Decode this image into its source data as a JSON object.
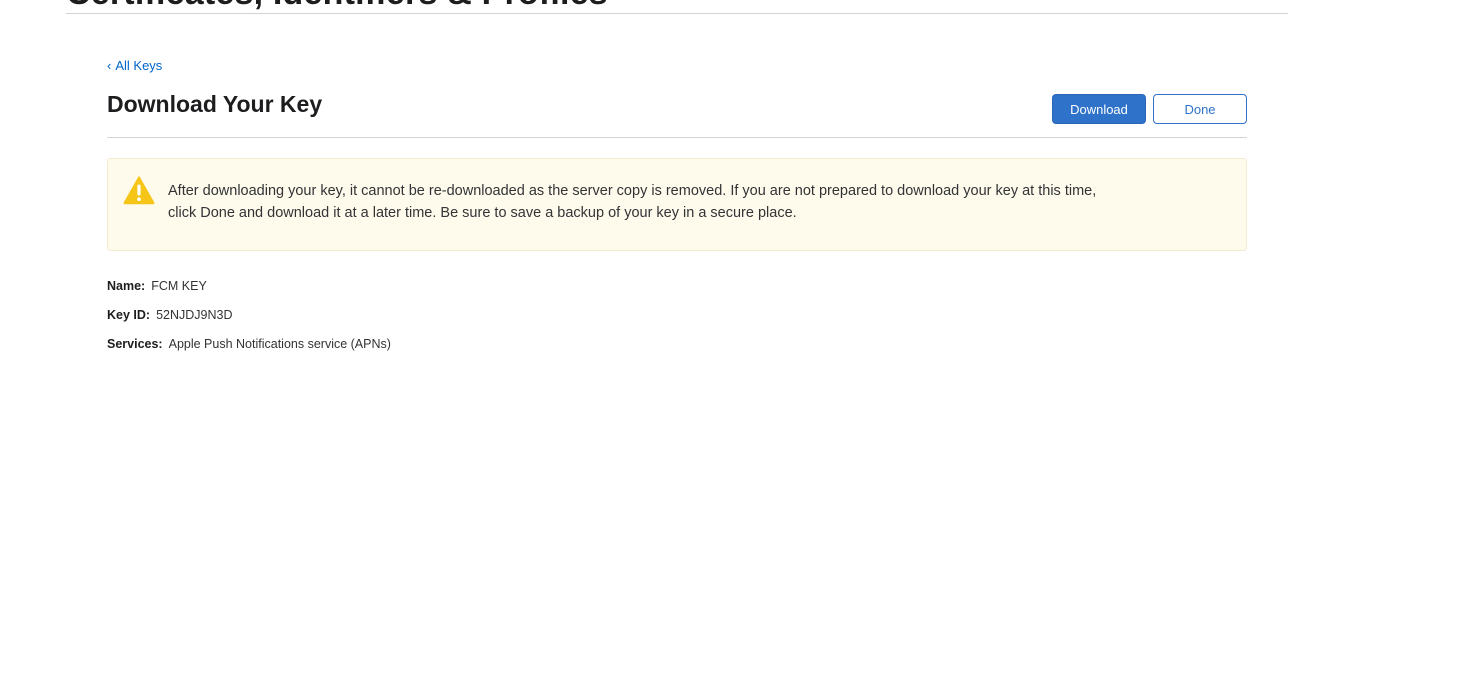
{
  "header": {
    "site_title": "Certificates, Identifiers & Profiles"
  },
  "nav": {
    "back_chevron": "‹",
    "back_label": "All Keys"
  },
  "page": {
    "title": "Download Your Key"
  },
  "actions": {
    "download_label": "Download",
    "done_label": "Done"
  },
  "warning": {
    "icon": "warning-triangle-icon",
    "message": "After downloading your key, it cannot be re-downloaded as the server copy is removed. If you are not prepared to download your key at this time, click Done and download it at a later time. Be sure to save a backup of your key in a secure place."
  },
  "key_details": {
    "name_label": "Name:",
    "name_value": "FCM KEY",
    "key_id_label": "Key ID:",
    "key_id_value": "52NJDJ9N3D",
    "services_label": "Services:",
    "services_value": "Apple Push Notifications service (APNs)"
  },
  "colors": {
    "accent": "#2f72c9",
    "link": "#0066cc",
    "warning_bg": "#fefbec",
    "warning_icon": "#f5c518"
  }
}
